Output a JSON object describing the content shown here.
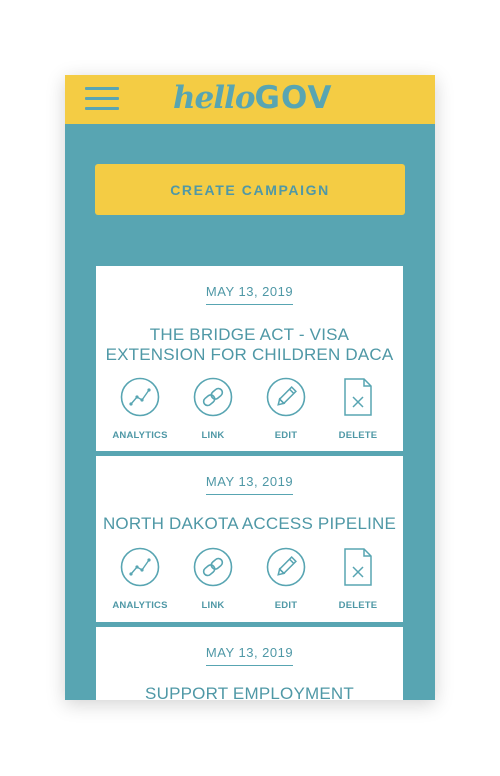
{
  "app": {
    "logo_hello": "hello",
    "logo_gov": "GOV",
    "brand_color": "#f4cc44",
    "accent_color": "#58a5b2"
  },
  "toolbar": {
    "menu_icon": "hamburger-menu-icon",
    "create_label": "CREATE CAMPAIGN"
  },
  "campaigns": [
    {
      "date": "MAY 13, 2019",
      "title_lines": [
        "THE BRIDGE ACT - VISA",
        "EXTENSION FOR CHILDREN DACA"
      ]
    },
    {
      "date": "MAY 13, 2019",
      "title_lines": [
        "NORTH DAKOTA ACCESS PIPELINE"
      ]
    },
    {
      "date": "MAY 13, 2019",
      "title_lines": [
        "SUPPORT EMPLOYMENT"
      ]
    }
  ],
  "actions": {
    "analytics_label": "ANALYTICS",
    "analytics_icon": "analytics-chart-icon",
    "link_label": "LINK",
    "link_icon": "chain-link-icon",
    "edit_label": "EDIT",
    "edit_icon": "pencil-icon",
    "delete_label": "DELETE",
    "delete_icon": "delete-document-icon"
  }
}
